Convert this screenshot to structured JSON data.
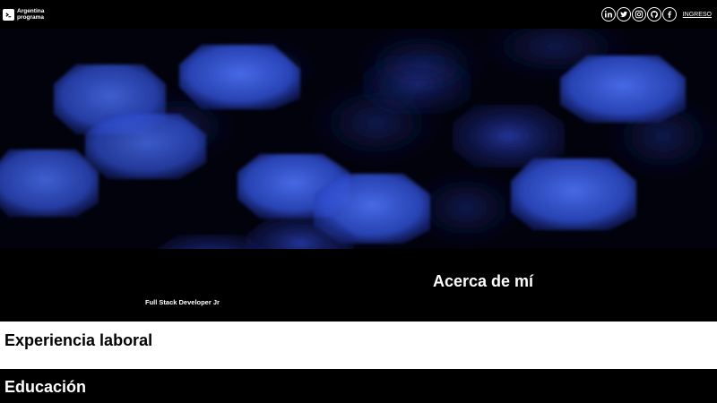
{
  "header": {
    "logo_line1": "Argentina",
    "logo_line2": "programa",
    "social_icons": [
      "linkedin-icon",
      "twitter-icon",
      "instagram-icon",
      "github-icon",
      "facebook-icon"
    ],
    "login_label": "INGRESO"
  },
  "about": {
    "title": "Acerca de mí",
    "role": "Full Stack Developer Jr"
  },
  "experience": {
    "title": "Experiencia laboral"
  },
  "education": {
    "title": "Educación"
  },
  "colors": {
    "background": "#000000",
    "section_light": "#ffffff",
    "bokeh_blue": "#3a5bd8"
  }
}
